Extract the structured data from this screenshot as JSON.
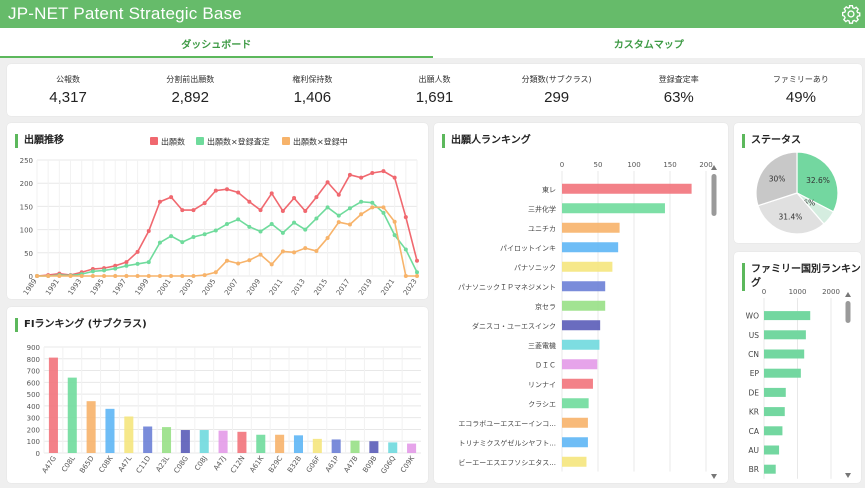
{
  "app": {
    "title": "JP-NET Patent Strategic Base"
  },
  "tabs": [
    {
      "label": "ダッシュボード",
      "active": true
    },
    {
      "label": "カスタムマップ",
      "active": false
    }
  ],
  "stats": [
    {
      "label": "公報数",
      "value": "4,317"
    },
    {
      "label": "分割前出願数",
      "value": "2,892"
    },
    {
      "label": "権利保持数",
      "value": "1,406"
    },
    {
      "label": "出願人数",
      "value": "1,691"
    },
    {
      "label": "分類数(サブクラス)",
      "value": "299"
    },
    {
      "label": "登録査定率",
      "value": "63%"
    },
    {
      "label": "ファミリーあり",
      "value": "49%"
    }
  ],
  "cards": {
    "trend": "出願推移",
    "fi": "FIランキング (サブクラス)",
    "applicant": "出願人ランキング",
    "status": "ステータス",
    "family": "ファミリー国別ランキング"
  },
  "colors": {
    "accent": "#66bb6a",
    "red": "#f0686f",
    "green": "#6fdb9c",
    "orange": "#f7b36a"
  },
  "chart_data": [
    {
      "type": "line",
      "x": [
        1989,
        1990,
        1991,
        1992,
        1993,
        1994,
        1995,
        1996,
        1997,
        1998,
        1999,
        2000,
        2001,
        2002,
        2003,
        2004,
        2005,
        2006,
        2007,
        2008,
        2009,
        2010,
        2011,
        2012,
        2013,
        2014,
        2015,
        2016,
        2017,
        2018,
        2019,
        2020,
        2021,
        2022,
        2023
      ],
      "xticks": [
        "1989",
        "1991",
        "1993",
        "1995",
        "1997",
        "1999",
        "2001",
        "2003",
        "2005",
        "2007",
        "2009",
        "2011",
        "2013",
        "2015",
        "2017",
        "2019",
        "2021",
        "2023"
      ],
      "ylim": [
        0,
        250
      ],
      "yticks": [
        0,
        50,
        100,
        150,
        200,
        250
      ],
      "series": [
        {
          "name": "出願数",
          "color": "#f0686f",
          "values": [
            0,
            2,
            5,
            2,
            8,
            15,
            17,
            22,
            30,
            52,
            97,
            160,
            170,
            142,
            142,
            157,
            184,
            187,
            180,
            160,
            142,
            178,
            140,
            168,
            140,
            170,
            202,
            175,
            218,
            212,
            222,
            226,
            212,
            127,
            33
          ]
        },
        {
          "name": "出願数×登録査定",
          "color": "#6fdb9c",
          "values": [
            0,
            0,
            2,
            1,
            4,
            10,
            12,
            16,
            22,
            26,
            30,
            72,
            86,
            73,
            84,
            90,
            98,
            112,
            122,
            106,
            96,
            112,
            93,
            115,
            100,
            124,
            148,
            130,
            146,
            160,
            158,
            136,
            88,
            57,
            8
          ]
        },
        {
          "name": "出願数×登録中",
          "color": "#f7b36a",
          "values": [
            0,
            0,
            0,
            0,
            0,
            0,
            0,
            0,
            0,
            0,
            0,
            0,
            0,
            0,
            0,
            2,
            8,
            33,
            27,
            34,
            46,
            25,
            53,
            51,
            60,
            54,
            82,
            116,
            111,
            133,
            148,
            148,
            117,
            0,
            0
          ]
        }
      ]
    },
    {
      "type": "bar",
      "categories": [
        "A47G",
        "C08L",
        "B65D",
        "C08K",
        "A47L",
        "C11D",
        "A23L",
        "C08G",
        "C08J",
        "A47J",
        "C12N",
        "A61K",
        "B29C",
        "B32B",
        "G06F",
        "A61P",
        "A47B",
        "B09B",
        "G06Q",
        "C09K"
      ],
      "values": [
        810,
        640,
        440,
        375,
        310,
        225,
        220,
        195,
        195,
        190,
        180,
        155,
        155,
        150,
        120,
        115,
        105,
        100,
        90,
        80
      ],
      "colors": [
        "#f2737b",
        "#6fdb9c",
        "#f7b36a",
        "#5eb6f5",
        "#f5e57d",
        "#6b7fd6",
        "#98e086",
        "#5a5cb8",
        "#6fd9de",
        "#e39ae8",
        "#f2737b",
        "#6fdb9c",
        "#f7b36a",
        "#5eb6f5",
        "#f5e57d",
        "#6b7fd6",
        "#98e086",
        "#5a5cb8",
        "#6fd9de",
        "#e39ae8"
      ],
      "ylim": [
        0,
        900
      ],
      "yticks": [
        0,
        100,
        200,
        300,
        400,
        500,
        600,
        700,
        800,
        900
      ]
    },
    {
      "type": "bar",
      "orientation": "horizontal",
      "categories": [
        "東レ",
        "三井化学",
        "ユニチカ",
        "パイロットインキ",
        "パナソニック",
        "パナソニックＩＰマネジメント",
        "京セラ",
        "ダニスコ・ユーエスインク",
        "三菱電機",
        "ＤＩＣ",
        "リンナイ",
        "クラシエ",
        "エコラボユーエスエーインコ...",
        "トリナミクスゲゼルシヤフト...",
        "ビーエーエスエフソシエタス..."
      ],
      "values": [
        180,
        143,
        80,
        78,
        70,
        60,
        60,
        53,
        52,
        49,
        43,
        37,
        36,
        36,
        34
      ],
      "colors": [
        "#f2737b",
        "#6fdb9c",
        "#f7b36a",
        "#5eb6f5",
        "#f5e57d",
        "#6b7fd6",
        "#98e086",
        "#5a5cb8",
        "#6fd9de",
        "#e39ae8",
        "#f2737b",
        "#6fdb9c",
        "#f7b36a",
        "#5eb6f5",
        "#f5e57d"
      ],
      "xlim": [
        0,
        200
      ],
      "xticks": [
        0,
        50,
        100,
        150,
        200
      ]
    },
    {
      "type": "pie",
      "labels": [
        "32.6%",
        "6%",
        "31.4%",
        "30%"
      ],
      "values": [
        32.6,
        6,
        31.4,
        30
      ],
      "colors": [
        "#73d7a0",
        "#d5ede0",
        "#e0e0e0",
        "#c8c8c8"
      ]
    },
    {
      "type": "bar",
      "orientation": "horizontal",
      "categories": [
        "WO",
        "US",
        "CN",
        "EP",
        "DE",
        "KR",
        "CA",
        "AU",
        "BR"
      ],
      "values": [
        1380,
        1250,
        1200,
        1100,
        650,
        620,
        550,
        450,
        350
      ],
      "color": "#73d7a0",
      "xlim": [
        0,
        2000
      ],
      "xticks": [
        0,
        1000,
        2000
      ]
    }
  ]
}
